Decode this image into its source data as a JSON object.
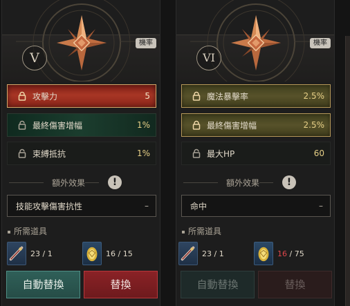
{
  "cards": [
    {
      "tier": "V",
      "prob_badge": "機率",
      "stats": [
        {
          "name": "攻擊力",
          "value": "5",
          "locked": true
        },
        {
          "name": "最終傷害增幅",
          "value": "1%",
          "locked": false
        },
        {
          "name": "束縛抵抗",
          "value": "1%",
          "locked": false
        }
      ],
      "extra": {
        "title": "額外效果",
        "value": "技能攻擊傷害抗性",
        "dash": "–"
      },
      "required": {
        "title": "所需道具",
        "item1": {
          "count": "23 / 1",
          "current": "23",
          "need": "1"
        },
        "item2": {
          "count": "16 / 15",
          "current": "16",
          "need": "15"
        }
      },
      "buttons": {
        "auto": "自動替換",
        "replace": "替換"
      }
    },
    {
      "tier": "VI",
      "prob_badge": "機率",
      "stats": [
        {
          "name": "魔法暴擊率",
          "value": "2.5%",
          "locked": true
        },
        {
          "name": "最終傷害增幅",
          "value": "2.5%",
          "locked": true
        },
        {
          "name": "最大HP",
          "value": "60",
          "locked": false
        }
      ],
      "extra": {
        "title": "額外效果",
        "value": "命中",
        "dash": "–"
      },
      "required": {
        "title": "所需道具",
        "item1": {
          "count": "23 / 1",
          "current": "23",
          "need": "1"
        },
        "item2": {
          "count": "16 / 75",
          "current": "16",
          "need": "75"
        }
      },
      "buttons": {
        "auto": "自動替換",
        "replace": "替換"
      }
    }
  ],
  "colors": {
    "accent_gold": "#e6cf86",
    "row_red": "#a83625",
    "row_green": "#1b3d2e",
    "row_olive": "#57522a",
    "warn_red": "#e0464a",
    "btn_teal": "#2f5f58",
    "btn_red": "#8a2226"
  }
}
